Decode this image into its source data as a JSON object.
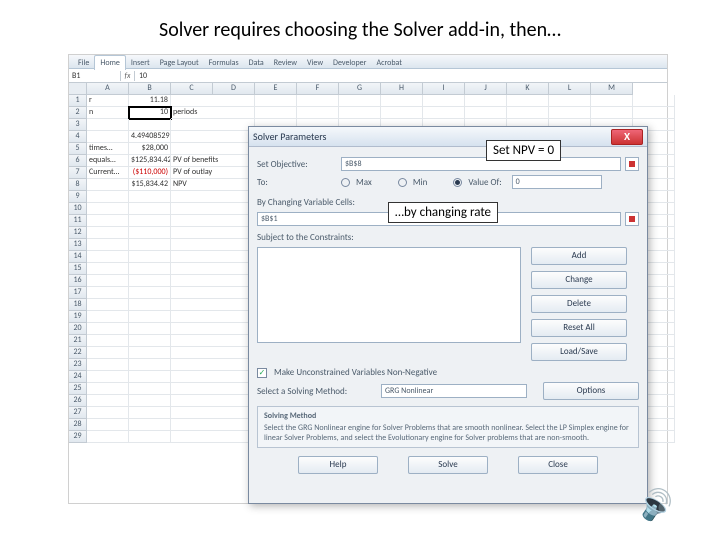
{
  "slide": {
    "title": "Solver requires choosing the Solver add-in, then…"
  },
  "annotations": {
    "set_npv": "Set NPV = 0",
    "by_rate": "…by changing rate"
  },
  "ribbon": {
    "tabs": [
      "File",
      "Home",
      "Insert",
      "Page Layout",
      "Formulas",
      "Data",
      "Review",
      "View",
      "Developer",
      "Acrobat"
    ],
    "active_index": 1
  },
  "namebox": "B1",
  "fx_label": "fx",
  "formula_value": "10",
  "columns": [
    "A",
    "B",
    "C",
    "D",
    "E",
    "F",
    "G",
    "H",
    "I",
    "J",
    "K",
    "L",
    "M"
  ],
  "row_count": 29,
  "cells": {
    "A1": "r",
    "B1": "11.18",
    "A2": "n",
    "B2": "10",
    "C2": "periods",
    "B4": "4.49408529",
    "A5": "times…",
    "B5": "$28,000",
    "A6": "equals…",
    "B6": "$125,834.42",
    "C6": "PV of benefits",
    "A7": "Current…",
    "B7": "($110,000)",
    "C7": "PV of outlay",
    "B8": "$15,834.42",
    "C8": "NPV"
  },
  "solver": {
    "title": "Solver Parameters",
    "close": "X",
    "labels": {
      "set_objective": "Set Objective:",
      "to": "To:",
      "max": "Max",
      "min": "Min",
      "value_of": "Value Of:",
      "changing": "By Changing Variable Cells:",
      "subject": "Subject to the Constraints:",
      "nonneg": "Make Unconstrained Variables Non-Negative",
      "method": "Select a Solving Method:",
      "method_box_title": "Solving Method",
      "method_desc": "Select the GRG Nonlinear engine for Solver Problems that are smooth nonlinear. Select the LP Simplex engine for linear Solver Problems, and select the Evolutionary engine for Solver problems that are non-smooth."
    },
    "objective_cell": "$B$8",
    "value_of": "0",
    "changing_cells": "$B$1",
    "nonneg_checked": true,
    "method_value": "GRG Nonlinear",
    "buttons": {
      "add": "Add",
      "change": "Change",
      "delete": "Delete",
      "reset": "Reset All",
      "loadsave": "Load/Save",
      "options": "Options",
      "help": "Help",
      "solve": "Solve",
      "close": "Close"
    }
  }
}
